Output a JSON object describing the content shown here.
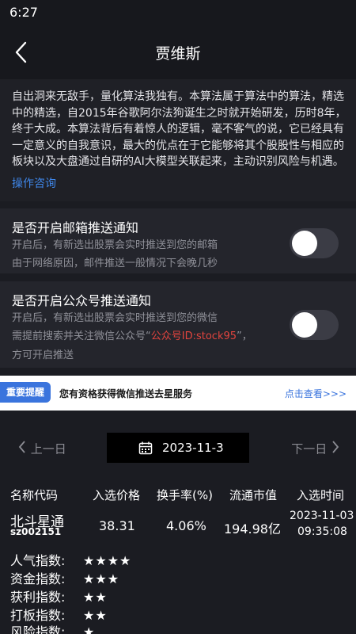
{
  "status_bar": {
    "time": "6:27"
  },
  "nav": {
    "title": "贾维斯"
  },
  "intro": {
    "text": "自出洞来无敌手，量化算法我独有。本算法属于算法中的算法，精选中的精选，自2015年谷歌阿尔法狗诞生之时就开始研发，历时8年，终于大成。本算法背后有着惊人的逻辑，毫不客气的说，它已经具有一定意义的自我意识，最大的优点在于它能够将其个股股性与相应的板块以及大盘通过自研的AI大模型关联起来，主动识别风险与机遇。",
    "link": "操作咨询"
  },
  "email_notice": {
    "title": "是否开启邮箱推送通知",
    "line1": "开启后，有新选出股票会实时推送到您的邮箱",
    "line2": "由于网络原因，邮件推送一般情况下会晚几秒"
  },
  "wechat_notice": {
    "title": "是否开启公众号推送通知",
    "line1": "开启后，有新选出股票会实时推送到您的微信",
    "line2_prefix": "需提前搜索并关注微信公众号“",
    "line2_highlight": "公众号ID:stock95",
    "line2_suffix": "”，",
    "line3": "方可开启推送"
  },
  "alert": {
    "badge": "重要提醒",
    "text": "您有资格获得微信推送去星服务",
    "link": "点击查看>>>"
  },
  "date_nav": {
    "prev": "上一日",
    "date": "2023-11-3",
    "next": "下一日"
  },
  "table": {
    "headers": [
      "名称代码",
      "入选价格",
      "换手率(%)",
      "流通市值",
      "入选时间"
    ],
    "row": {
      "name": "北斗星通",
      "code": "sz002151",
      "price": "38.31",
      "turnover": "4.06%",
      "market_cap": "194.98亿",
      "date": "2023-11-03",
      "time": "09:35:08"
    }
  },
  "indices": [
    {
      "label": "人气指数:",
      "stars": "★★★★"
    },
    {
      "label": "资金指数:",
      "stars": "★★★"
    },
    {
      "label": "获利指数:",
      "stars": "★★"
    },
    {
      "label": "打板指数:",
      "stars": "★★"
    },
    {
      "label": "风险指数:",
      "stars": "★"
    }
  ],
  "colors": {
    "background": "#1b1c22",
    "accent_blue": "#3a74dd",
    "highlight_red": "#e2443e"
  },
  "icons": {
    "back": "chevron-left-icon",
    "calendar": "calendar-icon",
    "prev": "chevron-left-icon",
    "next": "chevron-right-icon"
  }
}
